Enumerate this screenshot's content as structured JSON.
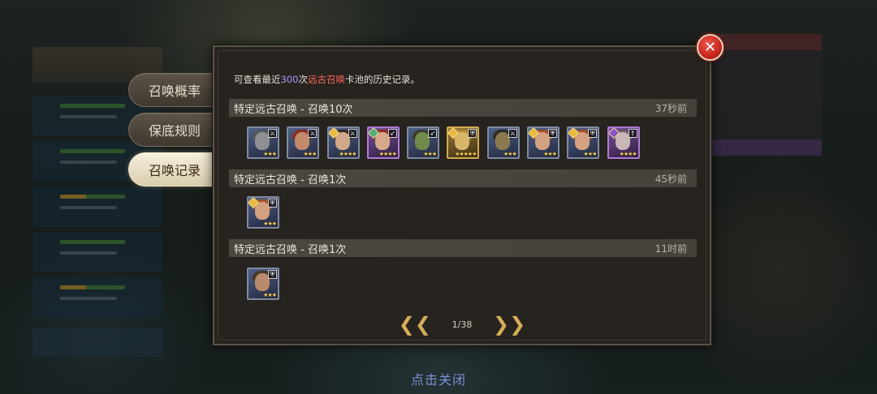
{
  "tabs": [
    {
      "label": "召唤概率",
      "active": false
    },
    {
      "label": "保底规则",
      "active": false
    },
    {
      "label": "召唤记录",
      "active": true
    }
  ],
  "intro": {
    "prefix": "可查看最近",
    "count": "300",
    "mid": "次",
    "pool": "远古召唤",
    "suffix": "卡池的历史记录。"
  },
  "records": [
    {
      "title": "特定远古召唤 - 召唤10次",
      "time": "37秒前",
      "heroes": [
        {
          "name": "armored-knight",
          "frame": "blue",
          "skin": "#8d8f93",
          "hair": "#55575c",
          "class_icon": "sword",
          "stars": "★★★"
        },
        {
          "name": "red-hood-archer",
          "frame": "blue",
          "skin": "#c28a6a",
          "hair": "#8a2f25",
          "class_icon": "sword",
          "stars": "★★★"
        },
        {
          "name": "dark-mage",
          "frame": "blue",
          "skin": "#d2a88a",
          "hair": "#3b2a1f",
          "class_icon": "sword",
          "element": "holy",
          "stars": "★★★★"
        },
        {
          "name": "elf-ranger",
          "frame": "purple",
          "skin": "#d7a98a",
          "hair": "#8a3426",
          "class_icon": "bow",
          "element": "nature",
          "stars": "★★★★"
        },
        {
          "name": "goblin-rogue",
          "frame": "blue",
          "skin": "#6f8a4a",
          "hair": "#3a3d2a",
          "class_icon": "bow",
          "stars": "★★★"
        },
        {
          "name": "golden-paladin",
          "frame": "gold",
          "skin": "#d9b56a",
          "hair": "#b88a2e",
          "class_icon": "shield",
          "element": "holy",
          "stars": "★★★★★"
        },
        {
          "name": "hooded-assassin",
          "frame": "blue",
          "skin": "#8a7a50",
          "hair": "#2f2b22",
          "class_icon": "sword",
          "stars": "★★★"
        },
        {
          "name": "red-haired-warrior",
          "frame": "blue",
          "skin": "#d3a080",
          "hair": "#a4522c",
          "class_icon": "shield",
          "element": "holy",
          "stars": "★★★"
        },
        {
          "name": "red-haired-warrior-2",
          "frame": "blue",
          "skin": "#d3a080",
          "hair": "#a4522c",
          "class_icon": "shield",
          "element": "holy",
          "stars": "★★★"
        },
        {
          "name": "vampire-lord",
          "frame": "purple",
          "skin": "#c9b6b8",
          "hair": "#6a5d66",
          "class_icon": "staff",
          "element": "dark",
          "stars": "★★★★"
        }
      ]
    },
    {
      "title": "特定远古召唤 - 召唤1次",
      "time": "45秒前",
      "heroes": [
        {
          "name": "red-haired-warrior",
          "frame": "blue",
          "skin": "#d3a080",
          "hair": "#a4522c",
          "class_icon": "shield",
          "element": "holy",
          "stars": "★★★"
        }
      ]
    },
    {
      "title": "特定远古召唤 - 召唤1次",
      "time": "11时前",
      "heroes": [
        {
          "name": "bearded-fighter",
          "frame": "blue",
          "skin": "#b98b6c",
          "hair": "#4a3525",
          "class_icon": "shield",
          "stars": "★★★"
        }
      ]
    }
  ],
  "pager": {
    "label": "1/38",
    "prev_icon": "double-chevron-left-icon",
    "next_icon": "double-chevron-right-icon"
  },
  "close_icon": "close-icon",
  "tap_to_close": "点击关闭",
  "colors": {
    "accent_gold": "#d6ad5a",
    "count_purple": "#a89cff",
    "pool_red": "#ff6a5a",
    "close_red": "#c7261f",
    "hint_blue": "#7f8ed6"
  }
}
